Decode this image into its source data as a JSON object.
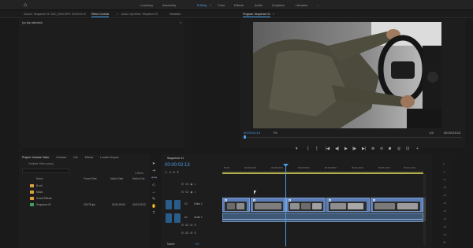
{
  "workspaces": {
    "items": [
      "Learning",
      "Assembly",
      "Editing",
      "Color",
      "Effects",
      "Audio",
      "Graphics",
      "Libraries"
    ],
    "active": "Editing"
  },
  "panel_tabs": {
    "source": "Source: Sequence 01: DSC_0042.MP4: 00:00:03:12",
    "effect_controls": "Effect Controls",
    "audio_clip_mixer": "Audio Clip Mixer: Sequence 01",
    "metadata": "Metadata",
    "program": "Program: Sequence 01"
  },
  "effect_controls": {
    "header": "(no clip selected)"
  },
  "program_monitor": {
    "timecode_current": "00:00:02:13",
    "timecode_duration": "00:00:23:23",
    "fit": "Fit",
    "quality": "1/2"
  },
  "transport": {
    "buttons": [
      "▾",
      "{",
      "}",
      "|◀",
      "◀|",
      "▶",
      "|▶",
      "▶|",
      "⊕",
      "⊝",
      "◙",
      "◎",
      "⊡",
      "+"
    ]
  },
  "project": {
    "tabs": [
      "Project: Youtube Video",
      "Libraries",
      "Info",
      "Effects",
      "Lumetri Scopes"
    ],
    "path": "Youtube Video.prproj",
    "item_count": "4 items",
    "columns": [
      "Name",
      "Frame Rate",
      "Media Start",
      "Media End"
    ],
    "rows": [
      {
        "name": "B-roll",
        "kind": "folder",
        "color": "#d9a23a",
        "fps": "",
        "start": "",
        "end": ""
      },
      {
        "name": "Music",
        "kind": "folder",
        "color": "#d9a23a",
        "fps": "",
        "start": "",
        "end": ""
      },
      {
        "name": "Sound Effects",
        "kind": "folder",
        "color": "#d9a23a",
        "fps": "",
        "start": "",
        "end": ""
      },
      {
        "name": "Sequence 01",
        "kind": "sequence",
        "color": "#3aa35a",
        "fps": "23.976 fps",
        "start": "00:00:00:00",
        "end": "00:00:23:22"
      }
    ]
  },
  "timeline": {
    "tab": "Sequence 01",
    "timecode": "00:00:02:13",
    "ruler": [
      "00:00",
      "00:00:02:00",
      "00:00:04:00",
      "00:00:06:00",
      "00:00:08:00",
      "00:00:10:00",
      "00:00:12:00",
      "00:00:14:00"
    ],
    "tracks": [
      "V3",
      "V2",
      "V1",
      "A1",
      "A2",
      "A3"
    ],
    "track_names": {
      "v1": "Video 1",
      "a1": "Audio 1",
      "master": "Master"
    },
    "master_value": "0.0"
  },
  "meters": {
    "labels": [
      "0",
      "-6",
      "-12",
      "-18",
      "-24",
      "-30",
      "-36",
      "-42",
      "-48",
      "-54",
      "dB"
    ]
  },
  "icons": {
    "home": "home-icon",
    "menu": "panel-menu-icon",
    "tools": [
      "selection-tool-icon",
      "track-select-icon",
      "ripple-edit-icon",
      "razor-tool-icon",
      "slip-tool-icon",
      "pen-tool-icon",
      "hand-tool-icon",
      "type-tool-icon"
    ]
  },
  "colors": {
    "accent": "#4a9ce6",
    "video_clip": "#5a7db8",
    "audio_clip": "#3e5876",
    "folder": "#d9a23a",
    "sequence": "#3aa35a",
    "in_out_bar": "#b3b04a"
  }
}
